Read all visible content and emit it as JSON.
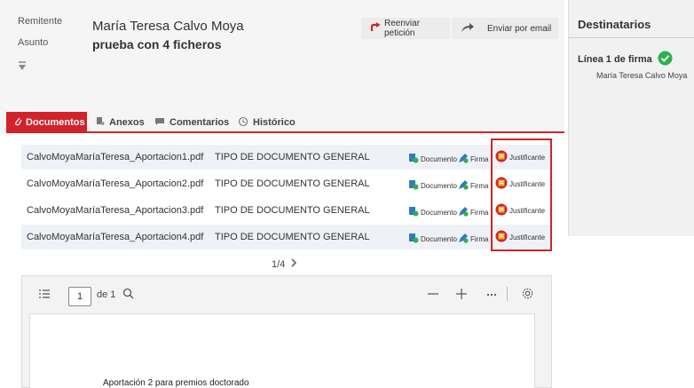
{
  "header": {
    "sender_label": "Remitente",
    "sender_name": "María Teresa Calvo Moya",
    "subject_label": "Asunto",
    "subject": "prueba con 4 ficheros",
    "forward_label": "Reenviar petición",
    "email_label": "Enviar por email"
  },
  "tabs": [
    {
      "label": "Documentos"
    },
    {
      "label": "Anexos"
    },
    {
      "label": "Comentarios"
    },
    {
      "label": "Histórico"
    }
  ],
  "documents": [
    {
      "name": "CalvoMoyaMaríaTeresa_Aportacion1.pdf",
      "type": "TIPO DE DOCUMENTO GENERAL"
    },
    {
      "name": "CalvoMoyaMaríaTeresa_Aportacion2.pdf",
      "type": "TIPO DE DOCUMENTO GENERAL"
    },
    {
      "name": "CalvoMoyaMaríaTeresa_Aportacion3.pdf",
      "type": "TIPO DE DOCUMENTO GENERAL"
    },
    {
      "name": "CalvoMoyaMaríaTeresa_Aportacion4.pdf",
      "type": "TIPO DE DOCUMENTO GENERAL"
    }
  ],
  "row_actions": {
    "documento": "Documento",
    "firma": "Firma",
    "justificante": "Justificante"
  },
  "pager": {
    "text": "1/4"
  },
  "viewer": {
    "page_value": "1",
    "page_of": "de 1",
    "page_text": "Aportación 2 para premios doctorado"
  },
  "right_panel": {
    "title": "Destinatarios",
    "line_label": "Línea 1 de firma",
    "signer": "María Teresa Calvo Moya"
  },
  "colors": {
    "accent": "#d2232a",
    "success": "#2bb24c",
    "doc_icon": "#2e7bbf"
  }
}
